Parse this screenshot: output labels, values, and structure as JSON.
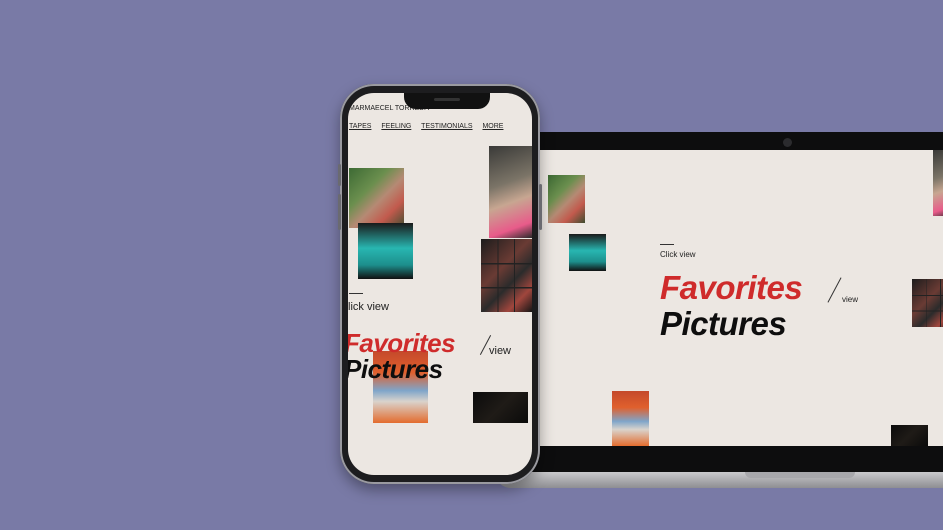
{
  "site": {
    "brand": "MARMAECEL TORREDA",
    "nav": [
      "TAPES",
      "FEELING",
      "TESTIMONIALS",
      "MORE"
    ],
    "click_view_mobile": "lick view",
    "click_view_desktop": "Click view",
    "title_line1": "Favorites",
    "title_line2": "Pictures",
    "view_label": "view"
  },
  "colors": {
    "background": "#797aa6",
    "page": "#ece7e2",
    "accent_red": "#cf2b2b",
    "text_dark": "#0e0e0e"
  }
}
